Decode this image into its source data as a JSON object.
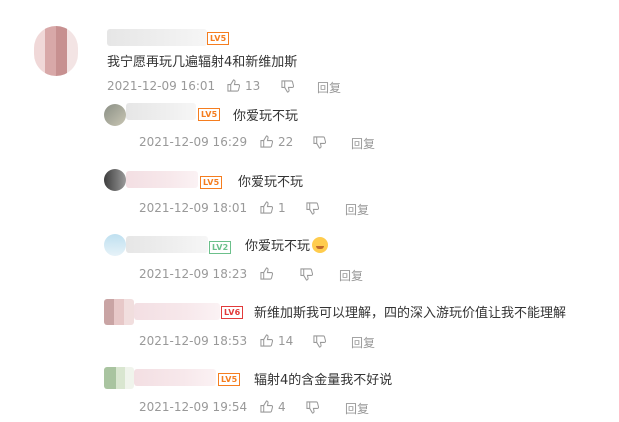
{
  "badges": {
    "lv5": "LV5",
    "lv2": "LV2",
    "lv6": "LV6"
  },
  "comments": [
    {
      "text": "我宁愿再玩几遍辐射4和新维加斯",
      "time": "2021-12-09 16:01",
      "likes": "13",
      "reply": "回复"
    },
    {
      "text": "你爱玩不玩",
      "time": "2021-12-09 16:29",
      "likes": "22",
      "reply": "回复"
    },
    {
      "text": "你爱玩不玩",
      "time": "2021-12-09 18:01",
      "likes": "1",
      "reply": "回复"
    },
    {
      "text": "你爱玩不玩",
      "time": "2021-12-09 18:23",
      "likes": "",
      "reply": "回复"
    },
    {
      "text": "新维加斯我可以理解，四的深入游玩价值让我不能理解",
      "time": "2021-12-09 18:53",
      "likes": "14",
      "reply": "回复"
    },
    {
      "text": "辐射4的含金量我不好说",
      "time": "2021-12-09 19:54",
      "likes": "4",
      "reply": "回复"
    }
  ],
  "colors": {
    "text": "#333333",
    "meta": "#999999",
    "badge_orange": "#f57d1f",
    "badge_green": "#6cc08b",
    "badge_red": "#e23a3a"
  },
  "icons": {
    "like": "thumbs-up-icon",
    "dislike": "thumbs-down-icon",
    "emoji": "grinning-face-emoji"
  }
}
